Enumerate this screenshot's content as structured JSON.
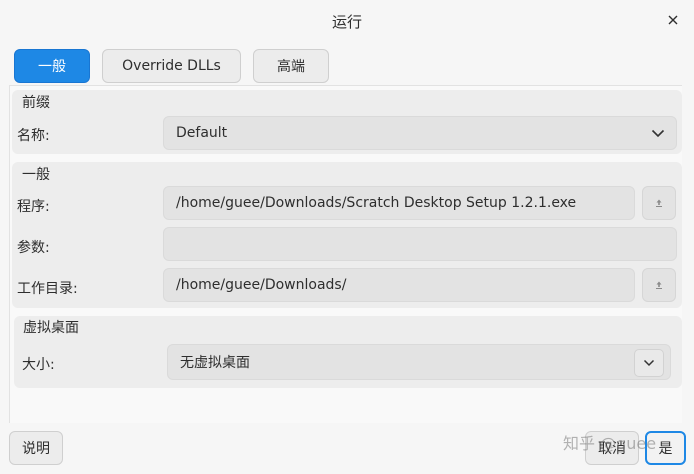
{
  "window": {
    "title": "运行"
  },
  "tabs": [
    {
      "label": "一般",
      "active": true
    },
    {
      "label": "Override DLLs",
      "active": false
    },
    {
      "label": "高端",
      "active": false
    }
  ],
  "prefix_section": {
    "title": "前缀",
    "name_label": "名称:",
    "name_value": "Default"
  },
  "general_section": {
    "title": "一般",
    "program_label": "程序:",
    "program_value": "/home/guee/Downloads/Scratch Desktop Setup 1.2.1.exe",
    "args_label": "参数:",
    "args_value": "",
    "workdir_label": "工作目录:",
    "workdir_value": "/home/guee/Downloads/"
  },
  "desktop_section": {
    "title": "虚拟桌面",
    "size_label": "大小:",
    "size_value": "无虚拟桌面"
  },
  "footer": {
    "help_label": "说明",
    "cancel_label": "取消",
    "ok_label": "是",
    "watermark": "知乎 @guee"
  },
  "colors": {
    "accent": "#1e88e5",
    "background": "#f6f6f6",
    "field": "#e3e3e3"
  },
  "icons": {
    "close": "close-icon",
    "dropdown": "chevron-down-icon",
    "file_picker": "upload-icon"
  }
}
